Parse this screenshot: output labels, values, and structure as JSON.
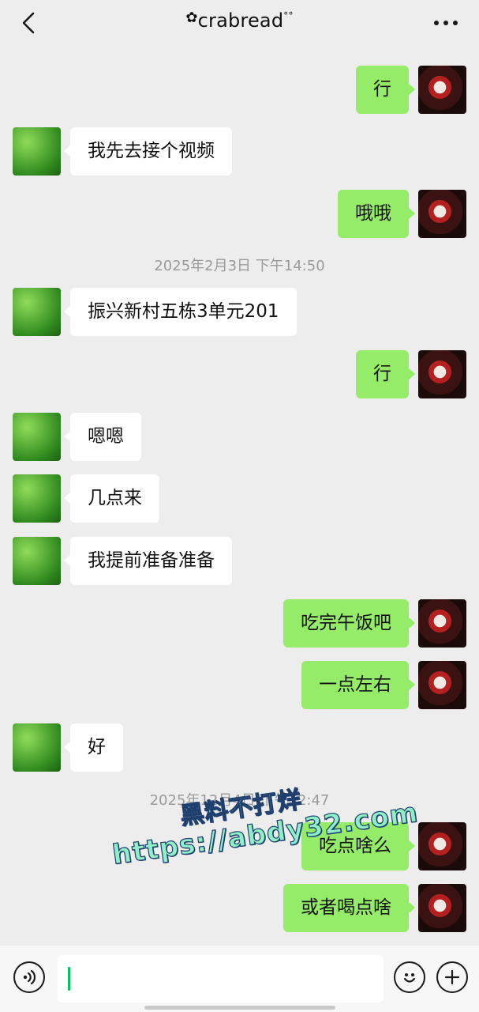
{
  "header": {
    "title": "crabread",
    "back_icon": "chevron-left-icon",
    "more_icon": "more-dots-icon"
  },
  "messages": [
    {
      "side": "right",
      "text": "行"
    },
    {
      "side": "left",
      "text": "我先去接个视频"
    },
    {
      "side": "right",
      "text": "哦哦"
    },
    {
      "type": "time",
      "text": "2025年2月3日 下午14:50"
    },
    {
      "side": "left",
      "text": "振兴新村五栋3单元201"
    },
    {
      "side": "right",
      "text": "行"
    },
    {
      "side": "left",
      "text": "嗯嗯"
    },
    {
      "side": "left",
      "text": "几点来"
    },
    {
      "side": "left",
      "text": "我提前准备准备"
    },
    {
      "side": "right",
      "text": "吃完午饭吧"
    },
    {
      "side": "right",
      "text": "一点左右"
    },
    {
      "side": "left",
      "text": "好"
    },
    {
      "type": "time",
      "text": "2025年12月4日 下午12:47"
    },
    {
      "side": "right",
      "text": "吃点啥么"
    },
    {
      "side": "right",
      "text": "或者喝点啥"
    }
  ],
  "watermark": {
    "line1": "黑料不打烊",
    "line2": "https://abdy32.com"
  },
  "input_bar": {
    "voice_icon": "voice-icon",
    "emoji_icon": "emoji-icon",
    "plus_icon": "plus-icon",
    "text_value": ""
  },
  "colors": {
    "background": "#ededed",
    "sent_bubble": "#95ec69",
    "received_bubble": "#ffffff",
    "timestamp": "#9a9a9a",
    "caret": "#07c160"
  }
}
